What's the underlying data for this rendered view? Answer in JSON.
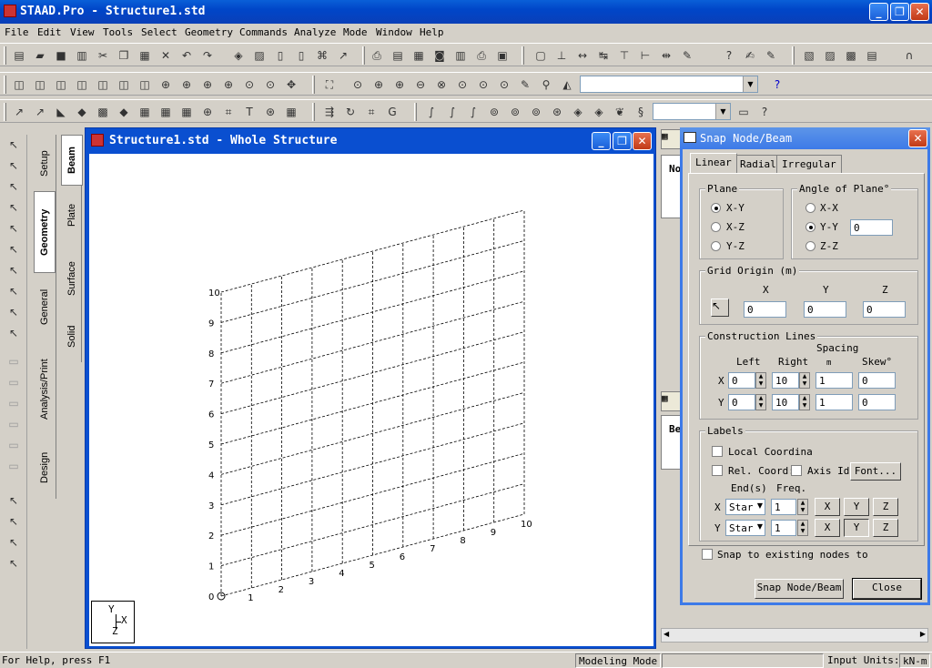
{
  "app": {
    "title": "STAAD.Pro - Structure1.std"
  },
  "menu": [
    "File",
    "Edit",
    "View",
    "Tools",
    "Select",
    "Geometry",
    "Commands",
    "Analyze",
    "Mode",
    "Window",
    "Help"
  ],
  "toolbar": {
    "units_combo": "",
    "help_icon": "?"
  },
  "left_tabs": [
    "Setup",
    "Geometry",
    "General",
    "Analysis/Print",
    "Design"
  ],
  "sub_tabs": [
    "Beam",
    "Plate",
    "Surface",
    "Solid"
  ],
  "mdi": {
    "title": "Structure1.std - Whole Structure"
  },
  "grid": {
    "y_labels": [
      "0",
      "1",
      "2",
      "3",
      "4",
      "5",
      "6",
      "7",
      "8",
      "9",
      "10"
    ],
    "x_labels": [
      "1",
      "2",
      "3",
      "4",
      "5",
      "6",
      "7",
      "8",
      "9",
      "10"
    ],
    "axis_triad": {
      "y": "Y",
      "x": "X",
      "z": "Z"
    }
  },
  "panel": {
    "label_no": "No",
    "label_be": "Be"
  },
  "dialog": {
    "title": "Snap Node/Beam",
    "tabs": [
      "Linear",
      "Radial",
      "Irregular"
    ],
    "plane": {
      "label": "Plane",
      "options": [
        "X-Y",
        "X-Z",
        "Y-Z"
      ],
      "selected": "X-Y"
    },
    "angle": {
      "label": "Angle of Plane°",
      "options": [
        "X-X",
        "Y-Y",
        "Z-Z"
      ],
      "selected": "Y-Y",
      "value": "0"
    },
    "origin": {
      "label": "Grid Origin  (m)",
      "x_label": "X",
      "y_label": "Y",
      "z_label": "Z",
      "x": "0",
      "y": "0",
      "z": "0"
    },
    "construction": {
      "label": "Construction Lines",
      "spacing": "Spacing",
      "left": "Left",
      "right": "Right",
      "unit": "m",
      "skew": "Skew°",
      "rows": [
        {
          "axis": "X",
          "left": "0",
          "right": "10",
          "spacing": "1",
          "skew": "0"
        },
        {
          "axis": "Y",
          "left": "0",
          "right": "10",
          "spacing": "1",
          "skew": "0"
        }
      ]
    },
    "labels": {
      "label": "Labels",
      "local_coord": "Local Coordina",
      "rel_coord": "Rel. Coord:",
      "axis_id": "Axis Id",
      "font_btn": "Font...",
      "ends": "End(s)",
      "freq": "Freq.",
      "rows": [
        {
          "axis": "X",
          "end": "Star",
          "freq": "1",
          "b1": "X",
          "b2": "Y",
          "b3": "Z"
        },
        {
          "axis": "Y",
          "end": "Star",
          "freq": "1",
          "b1": "X",
          "b2": "Y",
          "b3": "Z"
        }
      ]
    },
    "snap_existing": "Snap to existing nodes to",
    "snap_btn": "Snap Node/Beam",
    "close_btn": "Close"
  },
  "status": {
    "help": "For Help, press F1",
    "mode": "Modeling Mode",
    "input_units": "Input Units:",
    "units": "kN-m"
  }
}
